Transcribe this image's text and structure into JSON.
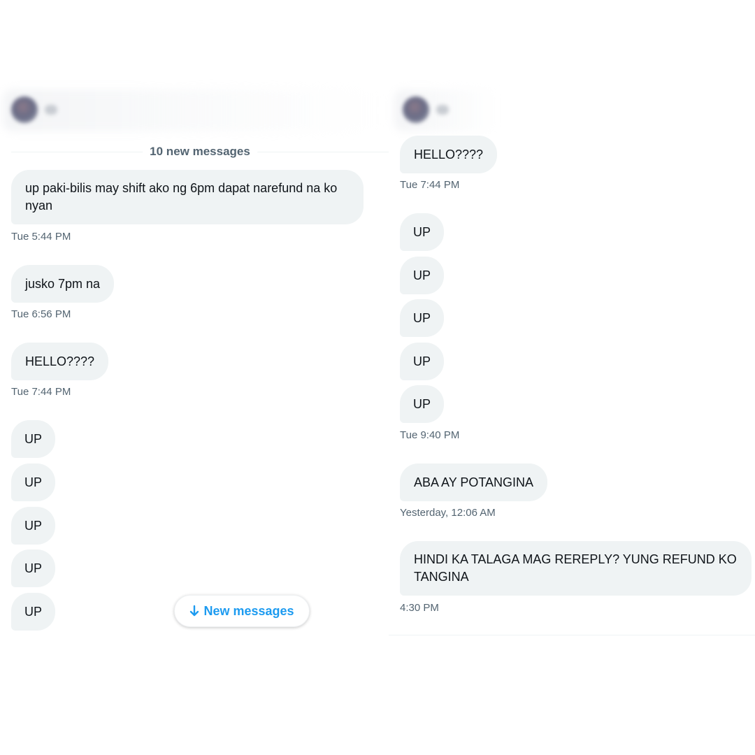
{
  "left": {
    "divider_label": "10 new messages",
    "messages": [
      {
        "text": "up paki-bilis may shift ako ng 6pm dapat narefund na ko nyan",
        "time": "Tue 5:44 PM"
      },
      {
        "text": "jusko 7pm na",
        "time": "Tue 6:56 PM"
      },
      {
        "text": "HELLO????",
        "time": "Tue 7:44 PM"
      },
      {
        "text": "UP"
      },
      {
        "text": "UP"
      },
      {
        "text": "UP"
      },
      {
        "text": "UP"
      },
      {
        "text": "UP"
      }
    ],
    "new_messages_button": {
      "icon": "arrow-down-icon",
      "label": "New messages"
    }
  },
  "right": {
    "messages": [
      {
        "text": "HELLO????",
        "time": "Tue 7:44 PM"
      },
      {
        "text": "UP"
      },
      {
        "text": "UP"
      },
      {
        "text": "UP"
      },
      {
        "text": "UP"
      },
      {
        "text": "UP",
        "time": "Tue 9:40 PM"
      },
      {
        "text": "ABA AY POTANGINA",
        "time": "Yesterday, 12:06 AM"
      },
      {
        "text": "HINDI KA TALAGA MAG REREPLY? YUNG REFUND KO TANGINA",
        "time": "4:30 PM"
      }
    ]
  },
  "colors": {
    "bubble_bg": "#eff3f4",
    "timestamp": "#536471",
    "accent": "#1d9bf0",
    "text": "#0f1419"
  }
}
